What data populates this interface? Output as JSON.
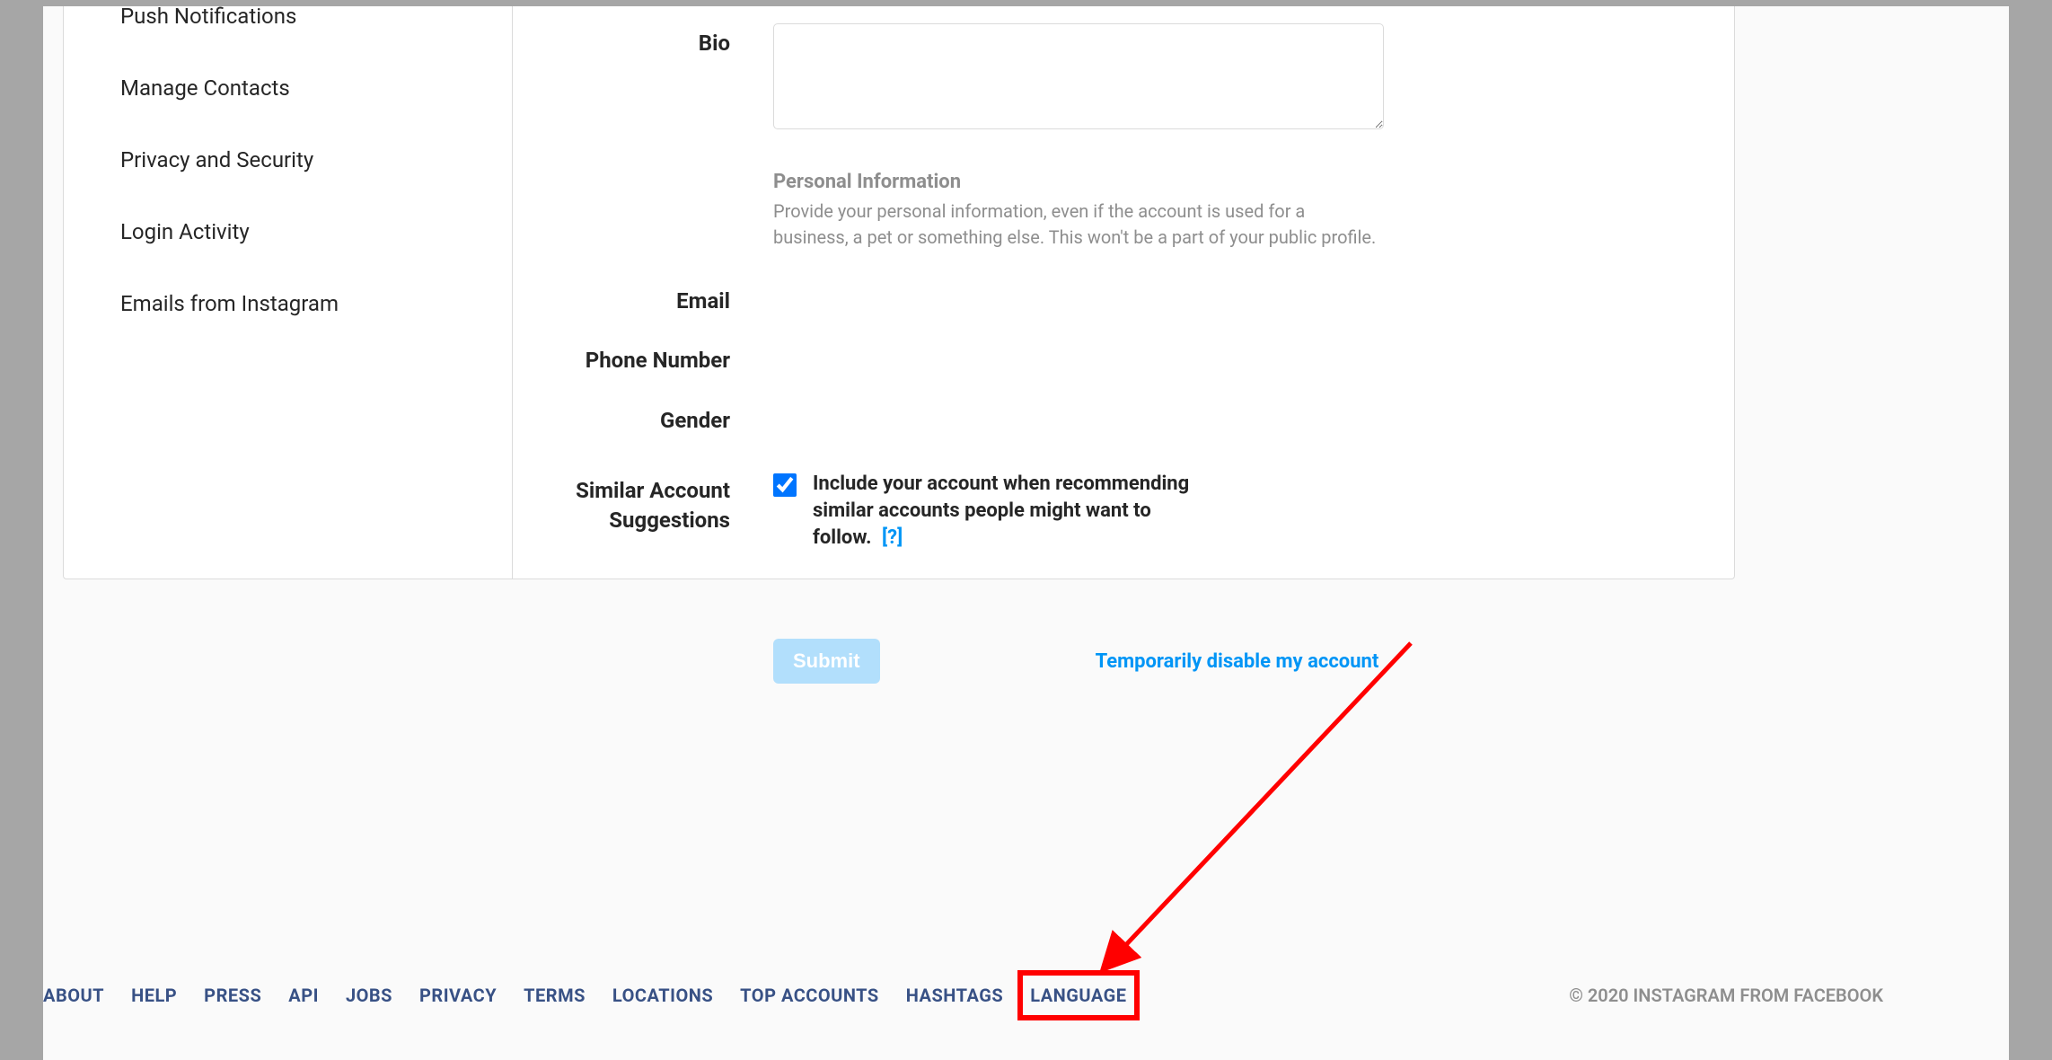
{
  "sidebar": {
    "items": [
      {
        "label": "Push Notifications"
      },
      {
        "label": "Manage Contacts"
      },
      {
        "label": "Privacy and Security"
      },
      {
        "label": "Login Activity"
      },
      {
        "label": "Emails from Instagram"
      }
    ]
  },
  "form": {
    "bio_label": "Bio",
    "bio_value": "",
    "personal_info_heading": "Personal Information",
    "personal_info_text": "Provide your personal information, even if the account is used for a business, a pet or something else. This won't be a part of your public profile.",
    "email_label": "Email",
    "email_value": "",
    "phone_label": "Phone Number",
    "phone_value": "",
    "gender_label": "Gender",
    "gender_value": "",
    "suggestions_label": "Similar Account Suggestions",
    "suggestions_checkbox_label": "Include your account when recommending similar accounts people might want to follow.",
    "suggestions_help": "[?]",
    "submit_label": "Submit",
    "disable_link": "Temporarily disable my account"
  },
  "footer": {
    "links": [
      "About",
      "Help",
      "Press",
      "API",
      "Jobs",
      "Privacy",
      "Terms",
      "Locations",
      "Top Accounts",
      "Hashtags",
      "Language"
    ],
    "copyright": "© 2020 Instagram from Facebook"
  },
  "annotation": {
    "highlight_target": "language-footer-link"
  }
}
